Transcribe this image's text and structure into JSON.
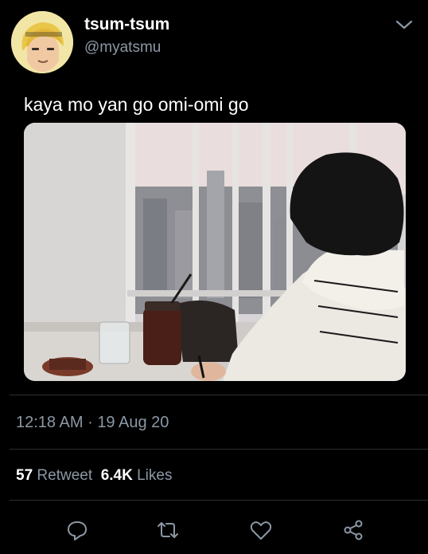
{
  "user": {
    "display_name": "tsum-tsum",
    "handle": "@myatsmu"
  },
  "tweet": {
    "text": "kaya mo yan go omi-omi go",
    "time": "12:18 AM",
    "separator": "·",
    "date": "19 Aug 20"
  },
  "stats": {
    "retweets_count": "57",
    "retweets_label": "Retweet",
    "likes_count": "6.4K",
    "likes_label": "Likes"
  },
  "icons": {
    "caret": "chevron-down-icon",
    "reply": "reply-icon",
    "retweet": "retweet-icon",
    "like": "heart-icon",
    "share": "share-icon"
  },
  "colors": {
    "background": "#000000",
    "primary_text": "#ffffff",
    "secondary_text": "#8b98a5",
    "divider": "#2a2f33"
  }
}
